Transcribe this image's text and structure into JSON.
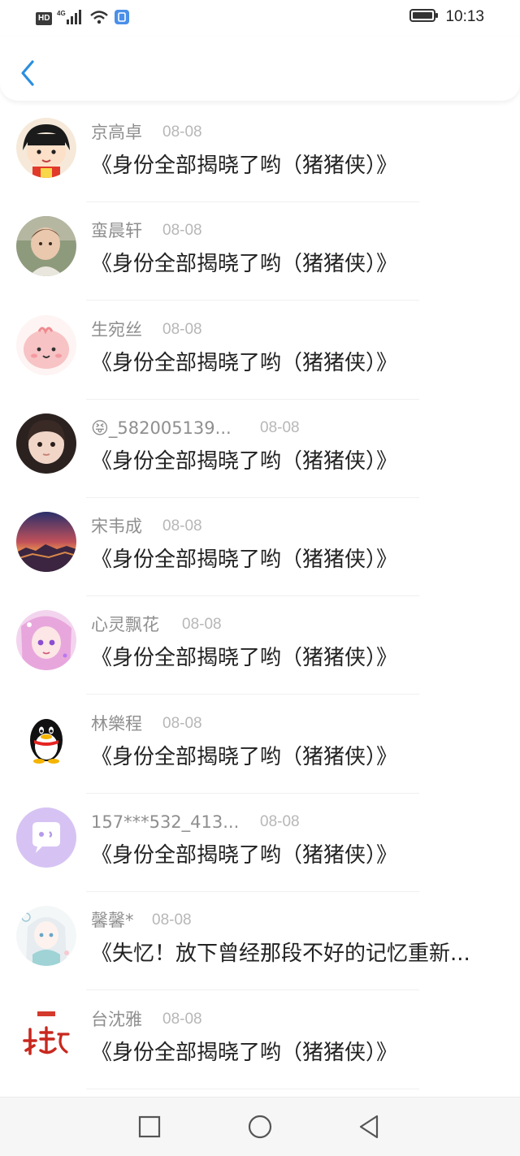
{
  "status_bar": {
    "hd": "HD",
    "network": "4G",
    "time": "10:13",
    "icons": [
      "signal-icon",
      "wifi-icon",
      "sim-app-icon",
      "battery-icon"
    ]
  },
  "header": {
    "back_icon": "chevron-left-icon",
    "accent": "#2a8fe0"
  },
  "list": [
    {
      "name": "京高卓",
      "date": "08-08",
      "title": "《身份全部揭晓了哟（猪猪侠）》",
      "avatar": "cartoon-girl-avatar"
    },
    {
      "name": "蛮晨轩",
      "date": "08-08",
      "title": "《身份全部揭晓了哟（猪猪侠）》",
      "avatar": "baby-photo-avatar"
    },
    {
      "name": "生宛丝",
      "date": "08-08",
      "title": "《身份全部揭晓了哟（猪猪侠）》",
      "avatar": "pink-cartoon-avatar"
    },
    {
      "name": "😝_582005139...",
      "date": "08-08",
      "title": "《身份全部揭晓了哟（猪猪侠）》",
      "avatar": "child-photo-avatar"
    },
    {
      "name": "宋韦成",
      "date": "08-08",
      "title": "《身份全部揭晓了哟（猪猪侠）》",
      "avatar": "great-wall-sunset-avatar"
    },
    {
      "name": "心灵飘花",
      "date": "08-08",
      "title": "《身份全部揭晓了哟（猪猪侠）》",
      "avatar": "anime-girl-avatar"
    },
    {
      "name": "林樂程",
      "date": "08-08",
      "title": "《身份全部揭晓了哟（猪猪侠）》",
      "avatar": "qq-penguin-avatar"
    },
    {
      "name": "157***532_413...",
      "date": "08-08",
      "title": "《身份全部揭晓了哟（猪猪侠）》",
      "avatar": "purple-chat-avatar"
    },
    {
      "name": "馨馨*",
      "date": "08-08",
      "title": "《失忆！放下曾经那段不好的记忆重新...",
      "avatar": "anime-sketch-avatar"
    },
    {
      "name": "台沈雅",
      "date": "08-08",
      "title": "《身份全部揭晓了哟（猪猪侠）》",
      "avatar": "red-calligraphy-avatar"
    }
  ],
  "nav_bar": {
    "icons": [
      "recent-apps-icon",
      "home-icon",
      "back-triangle-icon"
    ]
  }
}
